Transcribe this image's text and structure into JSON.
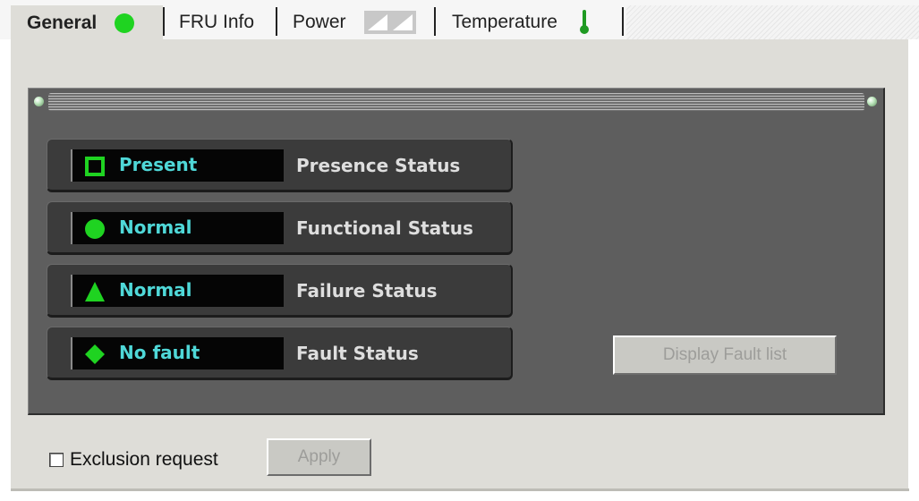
{
  "tabs": [
    {
      "label": "General",
      "icon": "green-circle-icon",
      "active": true
    },
    {
      "label": "FRU Info"
    },
    {
      "label": "Power",
      "icon": "power-unknown-icon"
    },
    {
      "label": "Temperature",
      "icon": "thermometer-icon"
    }
  ],
  "status_rows": [
    {
      "value": "Present",
      "label": "Presence Status",
      "icon": "square-outline-icon"
    },
    {
      "value": "Normal",
      "label": "Functional Status",
      "icon": "green-circle-icon"
    },
    {
      "value": "Normal",
      "label": "Failure Status",
      "icon": "green-triangle-icon"
    },
    {
      "value": "No fault",
      "label": "Fault Status",
      "icon": "green-diamond-icon"
    }
  ],
  "buttons": {
    "display_fault_list": "Display Fault list",
    "apply": "Apply"
  },
  "exclusion": {
    "label": "Exclusion request",
    "checked": false
  },
  "colors": {
    "status_green": "#1fd321",
    "value_text": "#4fd8d8",
    "panel_bg": "#5e5e5e",
    "window_bg": "#deddd8"
  }
}
